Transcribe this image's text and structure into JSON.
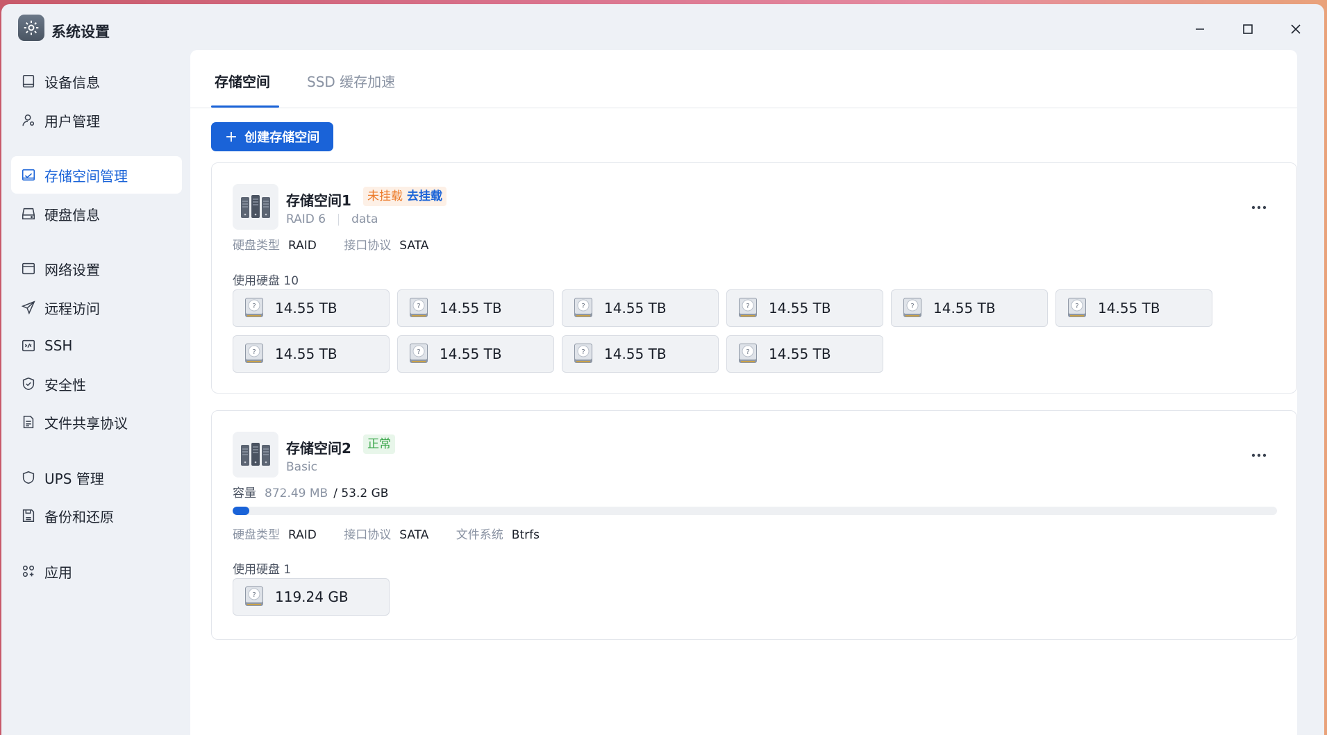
{
  "window": {
    "title": "系统设置",
    "app_icon": "gear-icon"
  },
  "sidebar": {
    "items": [
      {
        "label": "设备信息",
        "icon": "device-info-icon"
      },
      {
        "label": "用户管理",
        "icon": "user-icon"
      },
      {
        "label": "存储空间管理",
        "icon": "storage-icon",
        "active": true
      },
      {
        "label": "硬盘信息",
        "icon": "disk-icon"
      },
      {
        "label": "网络设置",
        "icon": "network-icon"
      },
      {
        "label": "远程访问",
        "icon": "send-icon"
      },
      {
        "label": "SSH",
        "icon": "terminal-icon"
      },
      {
        "label": "安全性",
        "icon": "shield-check-icon"
      },
      {
        "label": "文件共享协议",
        "icon": "document-icon"
      },
      {
        "label": "UPS 管理",
        "icon": "shield-icon"
      },
      {
        "label": "备份和还原",
        "icon": "backup-icon"
      },
      {
        "label": "应用",
        "icon": "apps-icon"
      }
    ]
  },
  "tabs": [
    {
      "label": "存储空间",
      "active": true
    },
    {
      "label": "SSD 缓存加速",
      "active": false
    }
  ],
  "toolbar": {
    "create_label": "创建存储空间"
  },
  "pools": [
    {
      "name": "存储空间1",
      "status": "未挂载",
      "status_action": "去挂载",
      "raid": "RAID 6",
      "volume": "data",
      "disk_type_label": "硬盘类型",
      "disk_type": "RAID",
      "protocol_label": "接口协议",
      "protocol": "SATA",
      "disks_label": "使用硬盘 10",
      "disks": [
        "14.55 TB",
        "14.55 TB",
        "14.55 TB",
        "14.55 TB",
        "14.55 TB",
        "14.55 TB",
        "14.55 TB",
        "14.55 TB",
        "14.55 TB",
        "14.55 TB"
      ]
    },
    {
      "name": "存储空间2",
      "status": "正常",
      "raid": "Basic",
      "capacity_label": "容量",
      "used": "872.49 MB",
      "total": "/ 53.2 GB",
      "usage_fraction": 0.016,
      "disk_type_label": "硬盘类型",
      "disk_type": "RAID",
      "protocol_label": "接口协议",
      "protocol": "SATA",
      "fs_label": "文件系统",
      "fs": "Btrfs",
      "disks_label": "使用硬盘 1",
      "disks": [
        "119.24 GB"
      ]
    }
  ],
  "colors": {
    "accent": "#1a63d8",
    "warn": "#ec7b2a",
    "ok": "#3aa64a"
  }
}
